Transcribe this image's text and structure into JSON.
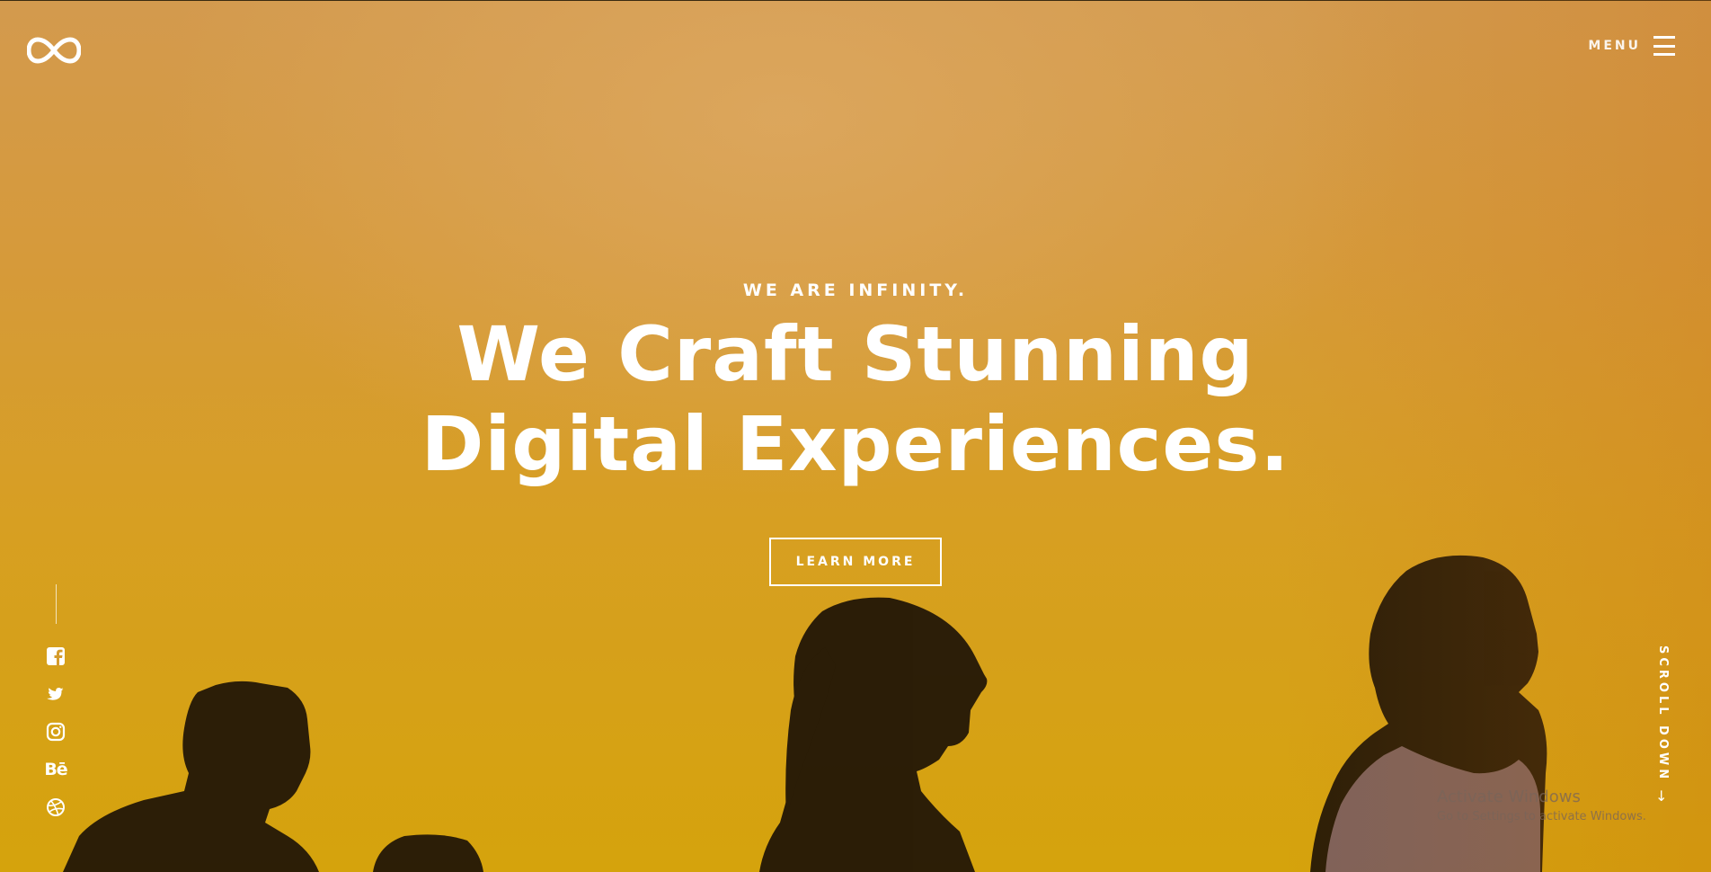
{
  "header": {
    "logo": {
      "icon": "infinity-icon"
    },
    "menu": {
      "label": "MENU",
      "icon": "hamburger-icon"
    }
  },
  "hero": {
    "eyebrow": "WE ARE INFINITY.",
    "headline": {
      "line1": "We Craft Stunning",
      "line2": "Digital Experiences."
    },
    "cta_label": "LEARN MORE",
    "background_colors": {
      "top": "#d39a4e",
      "bottom": "#d5a30c"
    }
  },
  "social": [
    {
      "name": "facebook",
      "icon": "facebook-icon"
    },
    {
      "name": "twitter",
      "icon": "twitter-icon"
    },
    {
      "name": "instagram",
      "icon": "instagram-icon"
    },
    {
      "name": "behance",
      "icon": "behance-icon",
      "glyph": "Bē"
    },
    {
      "name": "dribbble",
      "icon": "dribbble-icon"
    }
  ],
  "scroll": {
    "label": "SCROLL DOWN",
    "arrow": "↓"
  },
  "os_watermark": {
    "title": "Activate Windows",
    "subtitle": "Go to Settings to activate Windows."
  }
}
